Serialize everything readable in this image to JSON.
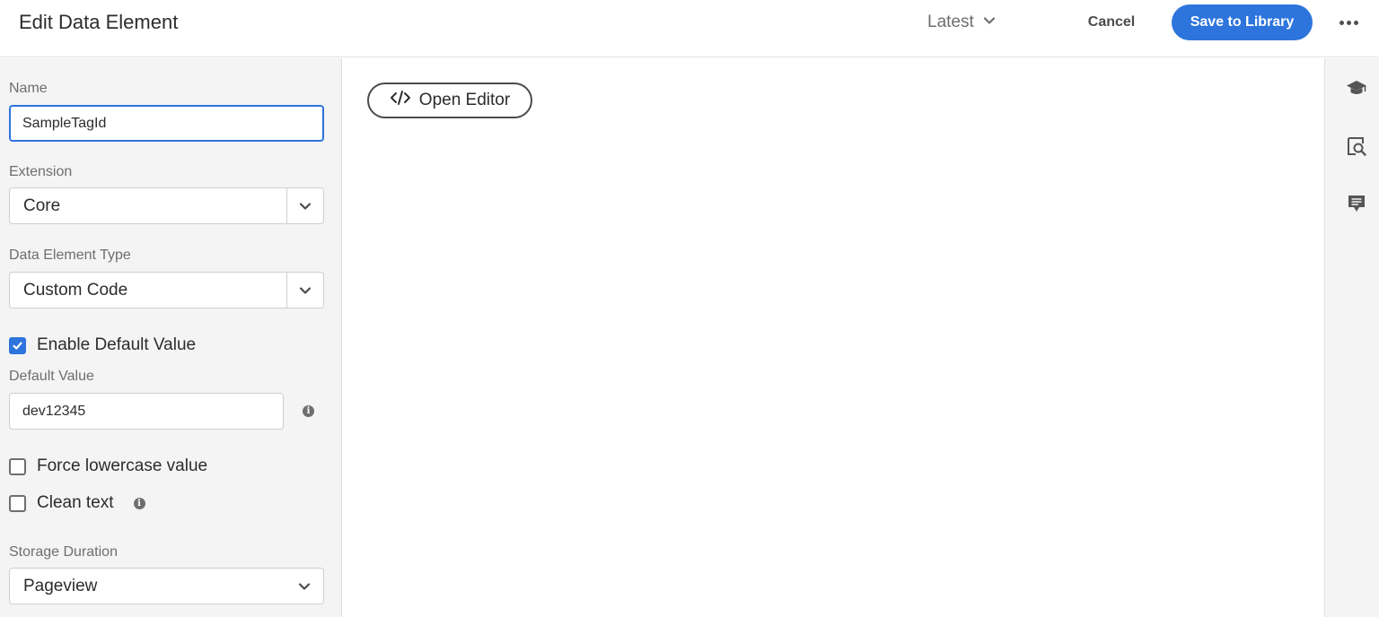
{
  "header": {
    "title": "Edit Data Element",
    "version_label": "Latest",
    "cancel_label": "Cancel",
    "save_label": "Save to Library"
  },
  "form": {
    "name_label": "Name",
    "name_value": "SampleTagId",
    "extension_label": "Extension",
    "extension_value": "Core",
    "type_label": "Data Element Type",
    "type_value": "Custom Code",
    "enable_default_label": "Enable Default Value",
    "enable_default_checked": true,
    "default_value_label": "Default Value",
    "default_value": "dev12345",
    "force_lowercase_label": "Force lowercase value",
    "force_lowercase_checked": false,
    "clean_text_label": "Clean text",
    "clean_text_checked": false,
    "storage_label": "Storage Duration",
    "storage_value": "Pageview"
  },
  "main": {
    "open_editor_label": "Open Editor"
  },
  "rail": {
    "icons": [
      "learn-icon",
      "preview-search-icon",
      "comment-icon"
    ]
  },
  "colors": {
    "accent": "#2d74dc",
    "panel_bg": "#f4f4f4"
  }
}
